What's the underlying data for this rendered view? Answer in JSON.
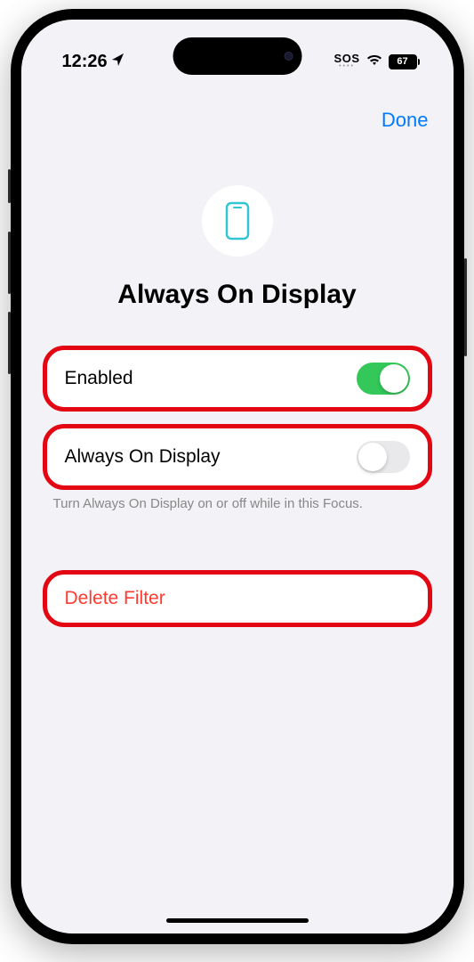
{
  "status_bar": {
    "time": "12:26",
    "sos_label": "SOS",
    "battery_level": "67"
  },
  "nav": {
    "done_label": "Done"
  },
  "header": {
    "title": "Always On Display"
  },
  "settings": {
    "enabled": {
      "label": "Enabled",
      "state": true
    },
    "always_on": {
      "label": "Always On Display",
      "state": false
    },
    "footer": "Turn Always On Display on or off while in this Focus."
  },
  "actions": {
    "delete_label": "Delete Filter"
  }
}
